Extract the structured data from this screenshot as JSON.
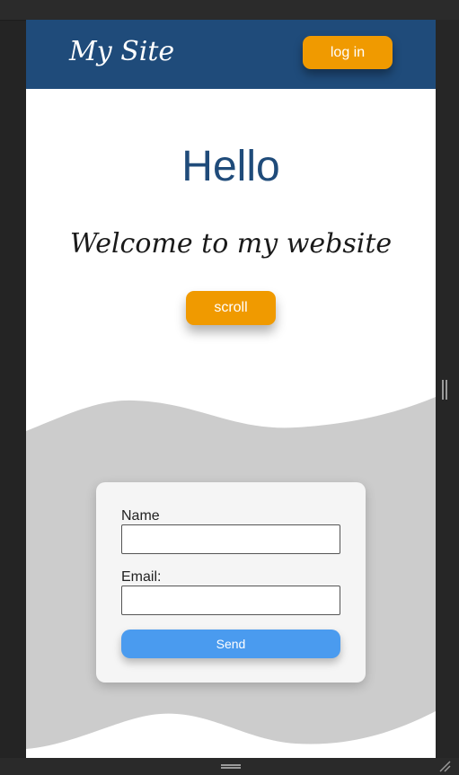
{
  "header": {
    "site_title": "My Site",
    "login_label": "log in"
  },
  "hero": {
    "title": "Hello",
    "subtitle": "Welcome to my website",
    "scroll_label": "scroll"
  },
  "form": {
    "name_label": "Name",
    "email_label": "Email:",
    "name_value": "",
    "email_value": "",
    "send_label": "Send"
  },
  "colors": {
    "header_bg": "#1f4b7a",
    "accent": "#f09a00",
    "send_button": "#4a9bef",
    "wave": "#cccccc"
  }
}
